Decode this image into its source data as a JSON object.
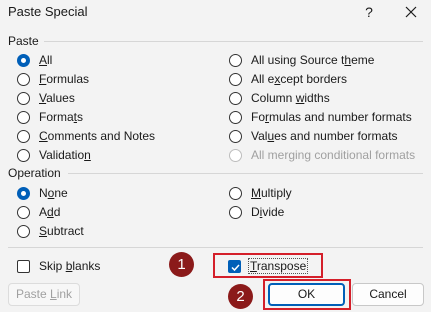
{
  "window": {
    "title": "Paste Special",
    "help_glyph": "?",
    "close_icon": "close-icon"
  },
  "paste": {
    "label": "Paste",
    "left_options": [
      {
        "label": "All",
        "selected": true,
        "disabled": false
      },
      {
        "label": "Formulas",
        "selected": false,
        "disabled": false
      },
      {
        "label": "Values",
        "selected": false,
        "disabled": false
      },
      {
        "label": "Formats",
        "selected": false,
        "disabled": false
      },
      {
        "label": "Comments and Notes",
        "selected": false,
        "disabled": false
      },
      {
        "label": "Validation",
        "selected": false,
        "disabled": false
      }
    ],
    "right_options": [
      {
        "label": "All using Source theme",
        "selected": false,
        "disabled": false
      },
      {
        "label": "All except borders",
        "selected": false,
        "disabled": false
      },
      {
        "label": "Column widths",
        "selected": false,
        "disabled": false
      },
      {
        "label": "Formulas and number formats",
        "selected": false,
        "disabled": false
      },
      {
        "label": "Values and number formats",
        "selected": false,
        "disabled": false
      },
      {
        "label": "All merging conditional formats",
        "selected": false,
        "disabled": true
      }
    ]
  },
  "operation": {
    "label": "Operation",
    "left_options": [
      {
        "label": "None",
        "selected": true
      },
      {
        "label": "Add",
        "selected": false
      },
      {
        "label": "Subtract",
        "selected": false
      }
    ],
    "right_options": [
      {
        "label": "Multiply",
        "selected": false
      },
      {
        "label": "Divide",
        "selected": false
      }
    ]
  },
  "skip_blanks": {
    "label": "Skip blanks",
    "checked": false
  },
  "transpose": {
    "label": "Transpose",
    "checked": true
  },
  "buttons": {
    "paste_link": "Paste Link",
    "ok": "OK",
    "cancel": "Cancel"
  },
  "annotations": {
    "step1": "1",
    "step2": "2"
  },
  "colors": {
    "accent": "#005fb8",
    "highlight_border": "#d41f2a",
    "badge_fill": "#8b1a1a"
  }
}
